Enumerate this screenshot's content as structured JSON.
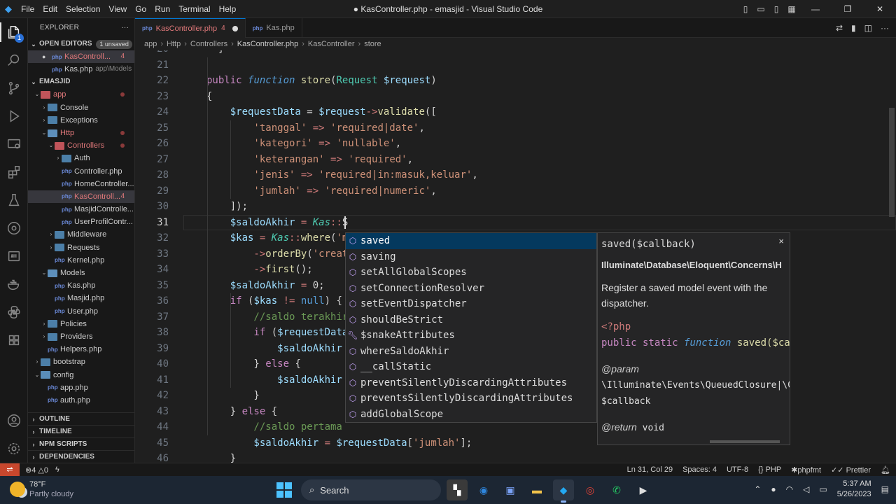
{
  "window": {
    "title": "● KasController.php - emasjid - Visual Studio Code",
    "menu": [
      "File",
      "Edit",
      "Selection",
      "View",
      "Go",
      "Run",
      "Terminal",
      "Help"
    ]
  },
  "activity": {
    "explorer_badge": "1"
  },
  "sidebar": {
    "title": "EXPLORER",
    "open_editors": {
      "label": "OPEN EDITORS",
      "pill": "1 unsaved",
      "items": [
        {
          "name": "KasControll...",
          "count": "4"
        },
        {
          "name": "Kas.php",
          "path": "app\\Models"
        }
      ]
    },
    "workspace": "EMASJID",
    "tree": [
      {
        "label": "app",
        "depth": 0,
        "type": "folder-red",
        "open": true,
        "dot": true,
        "red": true
      },
      {
        "label": "Console",
        "depth": 1,
        "type": "folder"
      },
      {
        "label": "Exceptions",
        "depth": 1,
        "type": "folder"
      },
      {
        "label": "Http",
        "depth": 1,
        "type": "folder-open",
        "open": true,
        "dot": true,
        "red": true
      },
      {
        "label": "Controllers",
        "depth": 2,
        "type": "folder-red",
        "open": true,
        "dot": true,
        "red": true
      },
      {
        "label": "Auth",
        "depth": 3,
        "type": "folder"
      },
      {
        "label": "Controller.php",
        "depth": 3,
        "type": "php"
      },
      {
        "label": "HomeController...",
        "depth": 3,
        "type": "php"
      },
      {
        "label": "KasControll...",
        "depth": 3,
        "type": "php",
        "count": "4",
        "red": true,
        "sel": true
      },
      {
        "label": "MasjidControlle...",
        "depth": 3,
        "type": "php"
      },
      {
        "label": "UserProfilContr...",
        "depth": 3,
        "type": "php"
      },
      {
        "label": "Middleware",
        "depth": 2,
        "type": "folder"
      },
      {
        "label": "Requests",
        "depth": 2,
        "type": "folder"
      },
      {
        "label": "Kernel.php",
        "depth": 2,
        "type": "php"
      },
      {
        "label": "Models",
        "depth": 1,
        "type": "folder-open",
        "open": true
      },
      {
        "label": "Kas.php",
        "depth": 2,
        "type": "php"
      },
      {
        "label": "Masjid.php",
        "depth": 2,
        "type": "php"
      },
      {
        "label": "User.php",
        "depth": 2,
        "type": "php"
      },
      {
        "label": "Policies",
        "depth": 1,
        "type": "folder"
      },
      {
        "label": "Providers",
        "depth": 1,
        "type": "folder"
      },
      {
        "label": "Helpers.php",
        "depth": 1,
        "type": "php"
      },
      {
        "label": "bootstrap",
        "depth": 0,
        "type": "folder"
      },
      {
        "label": "config",
        "depth": 0,
        "type": "folder-cfg",
        "open": true
      },
      {
        "label": "app.php",
        "depth": 1,
        "type": "php"
      },
      {
        "label": "auth.php",
        "depth": 1,
        "type": "php"
      }
    ],
    "bottom_sections": [
      "OUTLINE",
      "TIMELINE",
      "NPM SCRIPTS",
      "DEPENDENCIES"
    ]
  },
  "tabs": [
    {
      "label": "KasController.php",
      "count": "4",
      "active": true
    },
    {
      "label": "Kas.php"
    }
  ],
  "breadcrumb": [
    "app",
    "Http",
    "Controllers",
    "KasController.php",
    "KasController",
    "store"
  ],
  "editor": {
    "first_line": 20,
    "current_line": 31,
    "lines": [
      [
        [
          "op",
          "  }"
        ]
      ],
      [],
      [
        [
          "k",
          "public "
        ],
        [
          "kw",
          "function "
        ],
        [
          "fn",
          "store"
        ],
        [
          "op",
          "("
        ],
        [
          "ty",
          "Request "
        ],
        [
          "va",
          "$request"
        ],
        [
          "op",
          ")"
        ]
      ],
      [
        [
          "op",
          "{"
        ]
      ],
      [
        [
          "va",
          "    $requestData "
        ],
        [
          "op",
          "= "
        ],
        [
          "va",
          "$request"
        ],
        [
          "ar",
          "->"
        ],
        [
          "fn",
          "validate"
        ],
        [
          "op",
          "(["
        ]
      ],
      [
        [
          "st",
          "        'tanggal' "
        ],
        [
          "ar",
          "=> "
        ],
        [
          "st",
          "'required|date'"
        ],
        [
          "op",
          ","
        ]
      ],
      [
        [
          "st",
          "        'kategori' "
        ],
        [
          "ar",
          "=> "
        ],
        [
          "st",
          "'nullable'"
        ],
        [
          "op",
          ","
        ]
      ],
      [
        [
          "st",
          "        'keterangan' "
        ],
        [
          "ar",
          "=> "
        ],
        [
          "st",
          "'required'"
        ],
        [
          "op",
          ","
        ]
      ],
      [
        [
          "st",
          "        'jenis' "
        ],
        [
          "ar",
          "=> "
        ],
        [
          "st",
          "'required|in:masuk,keluar'"
        ],
        [
          "op",
          ","
        ]
      ],
      [
        [
          "st",
          "        'jumlah' "
        ],
        [
          "ar",
          "=> "
        ],
        [
          "st",
          "'required|numeric'"
        ],
        [
          "op",
          ","
        ]
      ],
      [
        [
          "op",
          "    ]);"
        ]
      ],
      [
        [
          "va",
          "    $saldoAkhir "
        ],
        [
          "ar",
          "= "
        ],
        [
          "cls",
          "Kas"
        ],
        [
          "ar",
          "::"
        ],
        [
          "op",
          "S"
        ]
      ],
      [
        [
          "va",
          "    $kas "
        ],
        [
          "ar",
          "= "
        ],
        [
          "cls",
          "Kas"
        ],
        [
          "ar",
          "::"
        ],
        [
          "fn",
          "where"
        ],
        [
          "op",
          "("
        ],
        [
          "st",
          "'m"
        ]
      ],
      [
        [
          "ar",
          "        ->"
        ],
        [
          "fn",
          "orderBy"
        ],
        [
          "op",
          "("
        ],
        [
          "st",
          "'creat"
        ]
      ],
      [
        [
          "ar",
          "        ->"
        ],
        [
          "fn",
          "first"
        ],
        [
          "op",
          "();"
        ]
      ],
      [
        [
          "va",
          "    $saldoAkhir "
        ],
        [
          "ar",
          "= "
        ],
        [
          "op",
          "0;"
        ]
      ],
      [
        [
          "k",
          "    if "
        ],
        [
          "op",
          "("
        ],
        [
          "va",
          "$kas "
        ],
        [
          "ar",
          "!= "
        ],
        [
          "kb",
          "null"
        ],
        [
          "op",
          ") {"
        ]
      ],
      [
        [
          "cm",
          "        //saldo terakhir"
        ]
      ],
      [
        [
          "k",
          "        if "
        ],
        [
          "op",
          "("
        ],
        [
          "va",
          "$requestData"
        ]
      ],
      [
        [
          "va",
          "            $saldoAkhir"
        ]
      ],
      [
        [
          "op",
          "        } "
        ],
        [
          "k",
          "else "
        ],
        [
          "op",
          "{"
        ]
      ],
      [
        [
          "va",
          "            $saldoAkhir"
        ]
      ],
      [
        [
          "op",
          "        }"
        ]
      ],
      [
        [
          "op",
          "    } "
        ],
        [
          "k",
          "else "
        ],
        [
          "op",
          "{"
        ]
      ],
      [
        [
          "cm",
          "        //saldo pertama"
        ]
      ],
      [
        [
          "va",
          "        $saldoAkhir "
        ],
        [
          "ar",
          "= "
        ],
        [
          "va",
          "$requestData"
        ],
        [
          "op",
          "["
        ],
        [
          "st",
          "'jumlah'"
        ],
        [
          "op",
          "];"
        ]
      ],
      [
        [
          "op",
          "    }"
        ]
      ]
    ]
  },
  "suggest": [
    "saved",
    "saving",
    "setAllGlobalScopes",
    "setConnectionResolver",
    "setEventDispatcher",
    "shouldBeStrict",
    "$snakeAttributes",
    "whereSaldoAkhir",
    "__callStatic",
    "preventSilentlyDiscardingAttributes",
    "preventsSilentlyDiscardingAttributes",
    "addGlobalScope"
  ],
  "docs": {
    "signature": "saved($callback)",
    "class": "Illuminate\\Database\\Eloquent\\Concerns\\H",
    "description": "Register a saved model event with the dispatcher.",
    "php_tag": "<?php",
    "decl_1": "public static ",
    "decl_2": "function ",
    "decl_3": "saved($cal",
    "param_tag": "@param",
    "param_type": " \\Illuminate\\Events\\QueuedClosure|\\C",
    "param_name": "$callback",
    "return_tag": "@return",
    "return_type": " void",
    "close": "×"
  },
  "status": {
    "errors": "4",
    "warnings": "0",
    "position": "Ln 31, Col 29",
    "spaces": "Spaces: 4",
    "encoding": "UTF-8",
    "language": "PHP",
    "formatter": "phpfmt",
    "prettier": "Prettier"
  },
  "taskbar": {
    "temp": "78°F",
    "weather": "Partly cloudy",
    "search": "Search",
    "time": "5:37 AM",
    "date": "5/26/2023"
  }
}
